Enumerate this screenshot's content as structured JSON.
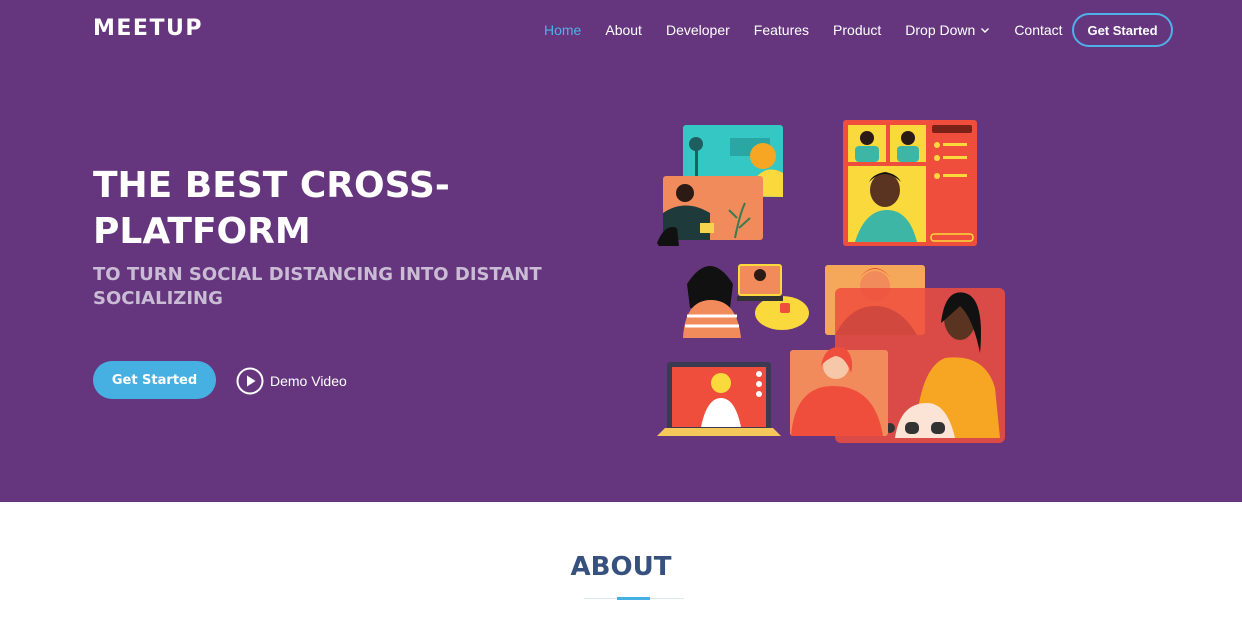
{
  "header": {
    "logo": "MEETUP",
    "nav": [
      {
        "label": "Home",
        "active": true
      },
      {
        "label": "About"
      },
      {
        "label": "Developer"
      },
      {
        "label": "Features"
      },
      {
        "label": "Product"
      },
      {
        "label": "Drop Down",
        "dropdown": true
      },
      {
        "label": "Contact"
      }
    ],
    "cta_label": "Get Started"
  },
  "hero": {
    "title": "THE BEST CROSS-PLATFORM",
    "subtitle": "TO TURN SOCIAL DISTANCING INTO DISTANT SOCIALIZING",
    "primary_button": "Get Started",
    "demo_button": "Demo Video"
  },
  "about": {
    "title": "ABOUT"
  },
  "colors": {
    "hero_bg": "#65367e",
    "accent": "#47b0e3",
    "heading": "#37517e"
  },
  "icons": {
    "play": "play-circle-icon",
    "chevron": "chevron-down-icon"
  }
}
